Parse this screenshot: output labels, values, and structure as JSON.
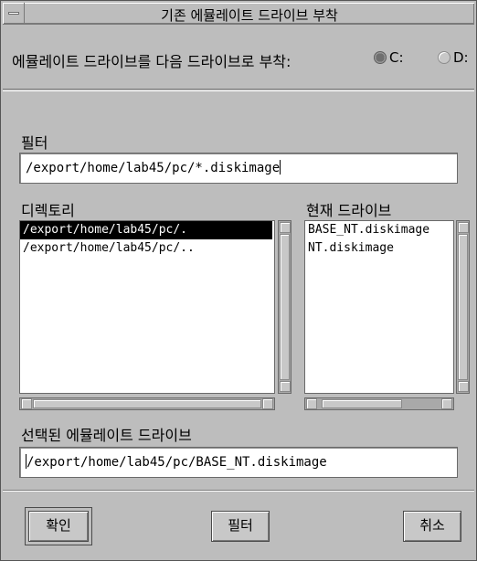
{
  "window": {
    "title": "기존 에뮬레이트 드라이브 부착"
  },
  "header": {
    "prompt": "에뮬레이트 드라이브를 다음 드라이브로 부착:",
    "drives": [
      {
        "label": "C:",
        "selected": true
      },
      {
        "label": "D:",
        "selected": false
      }
    ]
  },
  "filter": {
    "label": "필터",
    "value": "/export/home/lab45/pc/*.diskimage"
  },
  "directories": {
    "label": "디렉토리",
    "items": [
      {
        "text": "/export/home/lab45/pc/.",
        "selected": true
      },
      {
        "text": "/export/home/lab45/pc/..",
        "selected": false
      }
    ]
  },
  "current_drives": {
    "label": "현재 드라이브",
    "items": [
      {
        "text": "BASE_NT.diskimage"
      },
      {
        "text": "NT.diskimage"
      }
    ]
  },
  "selection": {
    "label": "선택된 에뮬레이트 드라이브",
    "value": "/export/home/lab45/pc/BASE_NT.diskimage"
  },
  "buttons": {
    "ok": "확인",
    "filter": "필터",
    "cancel": "취소"
  },
  "icons": {
    "window_menu": "window-menu-icon",
    "scroll_up": "scroll-up-arrow-icon",
    "scroll_down": "scroll-down-arrow-icon",
    "scroll_left": "scroll-left-arrow-icon",
    "scroll_right": "scroll-right-arrow-icon"
  },
  "colors": {
    "background": "#bdbdbd",
    "selection": "#000000",
    "field": "#ffffff"
  }
}
